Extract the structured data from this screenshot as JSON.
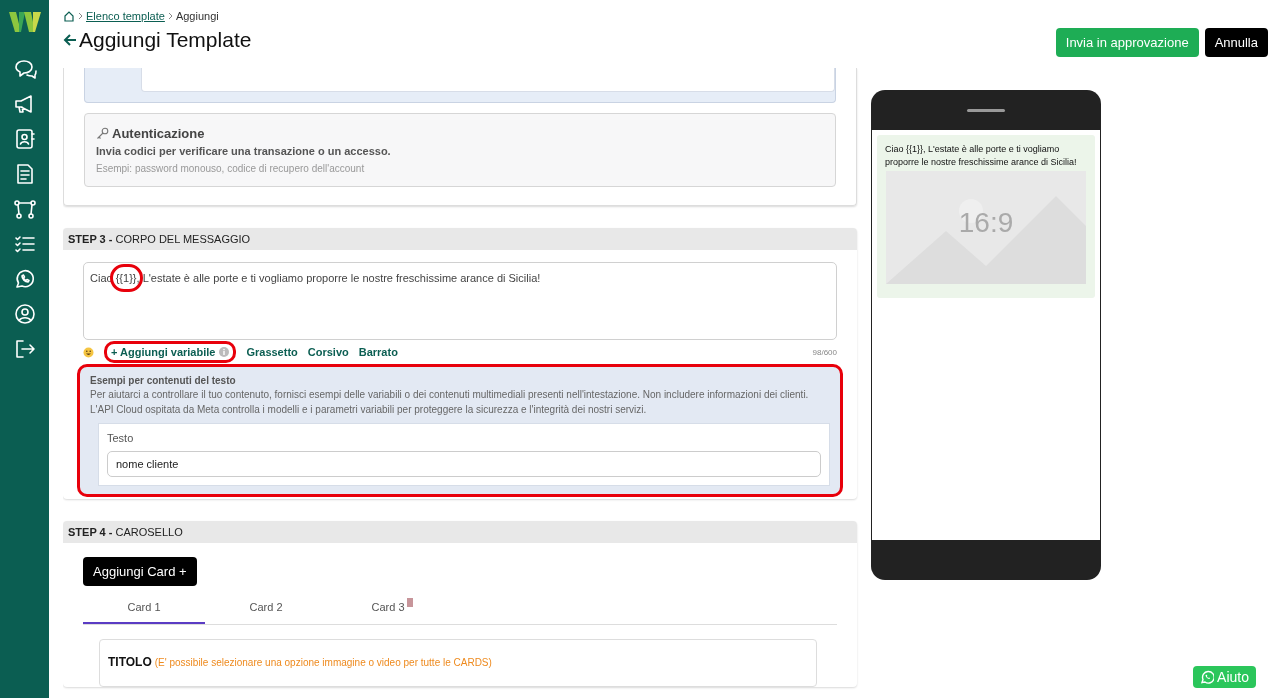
{
  "sidebar": {
    "items": [
      {
        "kind": "chat",
        "selected": false
      },
      {
        "kind": "megaphone",
        "selected": false
      },
      {
        "kind": "contacts",
        "selected": false
      },
      {
        "kind": "document",
        "selected": false
      },
      {
        "kind": "flow",
        "selected": false
      },
      {
        "kind": "checklist",
        "selected": false
      },
      {
        "kind": "whatsapp",
        "selected": false
      },
      {
        "kind": "user",
        "selected": false
      },
      {
        "kind": "logout",
        "selected": false
      }
    ]
  },
  "breadcrumb": [
    {
      "label": "Elenco template",
      "link": true
    },
    {
      "label": "Aggiungi",
      "link": false
    }
  ],
  "title": "Aggiungi Template",
  "actions": [
    {
      "label": "Invia in approvazione",
      "kind": "primary"
    },
    {
      "label": "Annulla",
      "kind": "dark"
    }
  ],
  "category": {
    "title": "Autenticazione",
    "description": "Invia codici per verificare una transazione o un accesso.",
    "examples": "Esempi: password monouso, codice di recupero dell'account"
  },
  "step3": {
    "step": "STEP 3 -",
    "title": "CORPO DEL MESSAGGIO",
    "message": [
      {
        "text": "Ciao ",
        "annotated": false
      },
      {
        "text": "{{1}}",
        "annotated": true
      },
      {
        "text": ", L'estate è alle porte e ti vogliamo proporre le nostre freschissime arance di Sicilia!",
        "annotated": false
      }
    ],
    "toolbar": [
      {
        "label": "+ Aggiungi variabile",
        "kind": "variable",
        "annotated": true
      },
      {
        "label": "Grassetto",
        "kind": "format",
        "annotated": false
      },
      {
        "label": "Corsivo",
        "kind": "format",
        "annotated": false
      },
      {
        "label": "Barrato",
        "kind": "format",
        "annotated": false
      }
    ],
    "counter": "98/600",
    "examples": {
      "annotated": true,
      "title": "Esempi per contenuti del testo",
      "text": "Per aiutarci a controllare il tuo contenuto, fornisci esempi delle variabili o dei contenuti multimediali presenti nell'intestazione. Non includere informazioni dei clienti. L'API Cloud ospitata da Meta controlla i modelli e i parametri variabili per proteggere la sicurezza e l'integrità dei nostri servizi.",
      "field_label": "Testo",
      "value": "nome cliente"
    }
  },
  "step4": {
    "step": "STEP 4 -",
    "title": "CAROSELLO",
    "add_button": "Aggiungi Card +",
    "tabs": [
      {
        "label": "Card 1",
        "selected": true
      },
      {
        "label": "Card 2",
        "selected": false
      },
      {
        "label": "Card 3",
        "selected": false
      }
    ],
    "card_title": "TITOLO",
    "card_hint": "(E' possibile selezionare una opzione immagine o video per tutte le CARDS)"
  },
  "preview": {
    "text": "Ciao {{1}}, L'estate è alle porte e ti vogliamo proporre le nostre freschissime arance di Sicilia!",
    "image_label": "16:9"
  },
  "help_button": "Aiuto"
}
